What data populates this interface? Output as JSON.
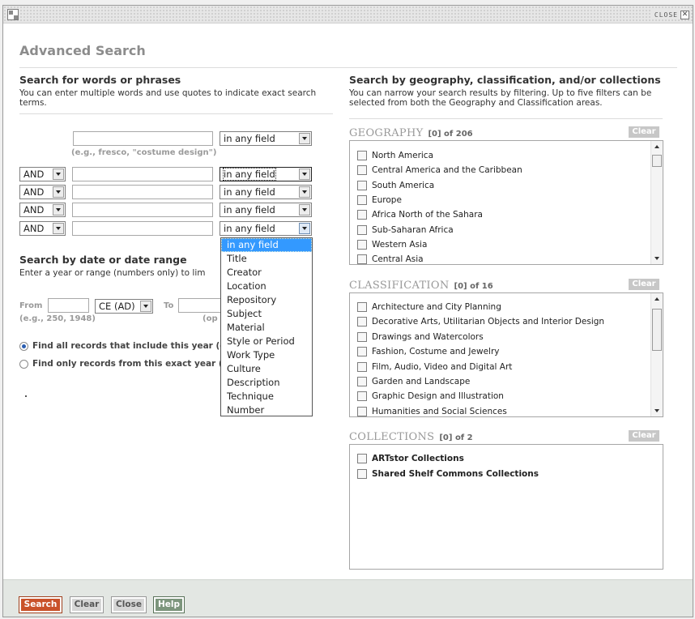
{
  "window": {
    "close_label": "CLOSE",
    "close_glyph": "✕"
  },
  "page_title": "Advanced Search",
  "words": {
    "heading": "Search for words or phrases",
    "description": "You can enter multiple words and use quotes to indicate exact search terms.",
    "hint": "(e.g., fresco, \"costume design\")",
    "rows": [
      {
        "operator": "",
        "field": "in any field"
      },
      {
        "operator": "AND",
        "field": "in any field"
      },
      {
        "operator": "AND",
        "field": "in any field"
      },
      {
        "operator": "AND",
        "field": "in any field"
      },
      {
        "operator": "AND",
        "field": "in any field"
      }
    ]
  },
  "field_dropdown": {
    "selected": "in any field",
    "options": [
      "in any field",
      "Title",
      "Creator",
      "Location",
      "Repository",
      "Subject",
      "Material",
      "Style or Period",
      "Work Type",
      "Culture",
      "Description",
      "Technique",
      "Number"
    ]
  },
  "date": {
    "heading": "Search by date or date range",
    "description": "Enter a year or range (numbers only) to lim",
    "from_label": "From",
    "era": "CE (AD)",
    "to_label": "To",
    "from_hint": "(e.g., 250, 1948)",
    "to_hint": "(op",
    "option_include": "Find all records that include this year (or",
    "option_exact": "Find only records from this exact year (c"
  },
  "filter": {
    "heading": "Search by geography, classification, and/or collections",
    "description": "You can narrow your search results by filtering. Up to five filters can be selected from both the Geography and Classification areas."
  },
  "geography": {
    "title": "GEOGRAPHY",
    "count": "[0] of 206",
    "clear": "Clear",
    "items": [
      "North America",
      "Central America and the Caribbean",
      "South America",
      "Europe",
      "Africa North of the Sahara",
      "Sub-Saharan Africa",
      "Western Asia",
      "Central Asia"
    ]
  },
  "classification": {
    "title": "CLASSIFICATION",
    "count": "[0] of 16",
    "clear": "Clear",
    "items": [
      "Architecture and City Planning",
      "Decorative Arts, Utilitarian Objects and Interior Design",
      "Drawings and Watercolors",
      "Fashion, Costume and Jewelry",
      "Film, Audio, Video and Digital Art",
      "Garden and Landscape",
      "Graphic Design and Illustration",
      "Humanities and Social Sciences"
    ]
  },
  "collections": {
    "title": "COLLECTIONS",
    "count": "[0] of 2",
    "clear": "Clear",
    "items": [
      "ARTstor Collections",
      "Shared Shelf Commons Collections"
    ]
  },
  "footer": {
    "search": "Search",
    "clear": "Clear",
    "close": "Close",
    "help": "Help"
  },
  "colors": {
    "search_button": "#c9522a",
    "help_button": "#7c957c",
    "selected_option": "#3399ff",
    "footer_bg": "#e3e7e3"
  }
}
